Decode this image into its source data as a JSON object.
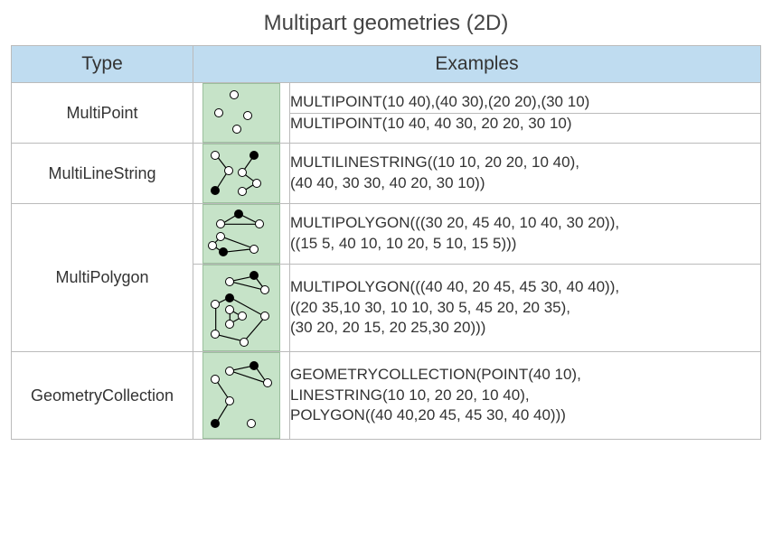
{
  "title": "Multipart geometries (2D)",
  "headers": {
    "type": "Type",
    "examples": "Examples"
  },
  "rows": {
    "multipoint": {
      "type": "MultiPoint",
      "ex1": "MULTIPOINT(10 40),(40 30),(20 20),(30 10)",
      "ex2": "MULTIPOINT(10 40, 40 30, 20 20, 30 10)"
    },
    "multilinestring": {
      "type": "MultiLineString",
      "ex": "MULTILINESTRING((10 10, 20 20, 10 40),\n(40 40, 30 30, 40 20, 30 10))"
    },
    "multipolygon": {
      "type": "MultiPolygon",
      "ex1": "MULTIPOLYGON(((30 20, 45 40, 10 40, 30 20)),\n((15 5, 40 10, 10 20, 5 10, 15 5)))",
      "ex2": "MULTIPOLYGON(((40 40, 20 45, 45 30, 40 40)),\n((20 35,10 30, 10 10, 30 5, 45 20, 20 35),\n(30 20, 20 15, 20 25,30 20)))"
    },
    "geometrycollection": {
      "type": "GeometryCollection",
      "ex": "GEOMETRYCOLLECTION(POINT(40 10),\nLINESTRING(10 10, 20 20, 10 40),\nPOLYGON((40 40,20 45, 45 30, 40 40)))"
    }
  }
}
